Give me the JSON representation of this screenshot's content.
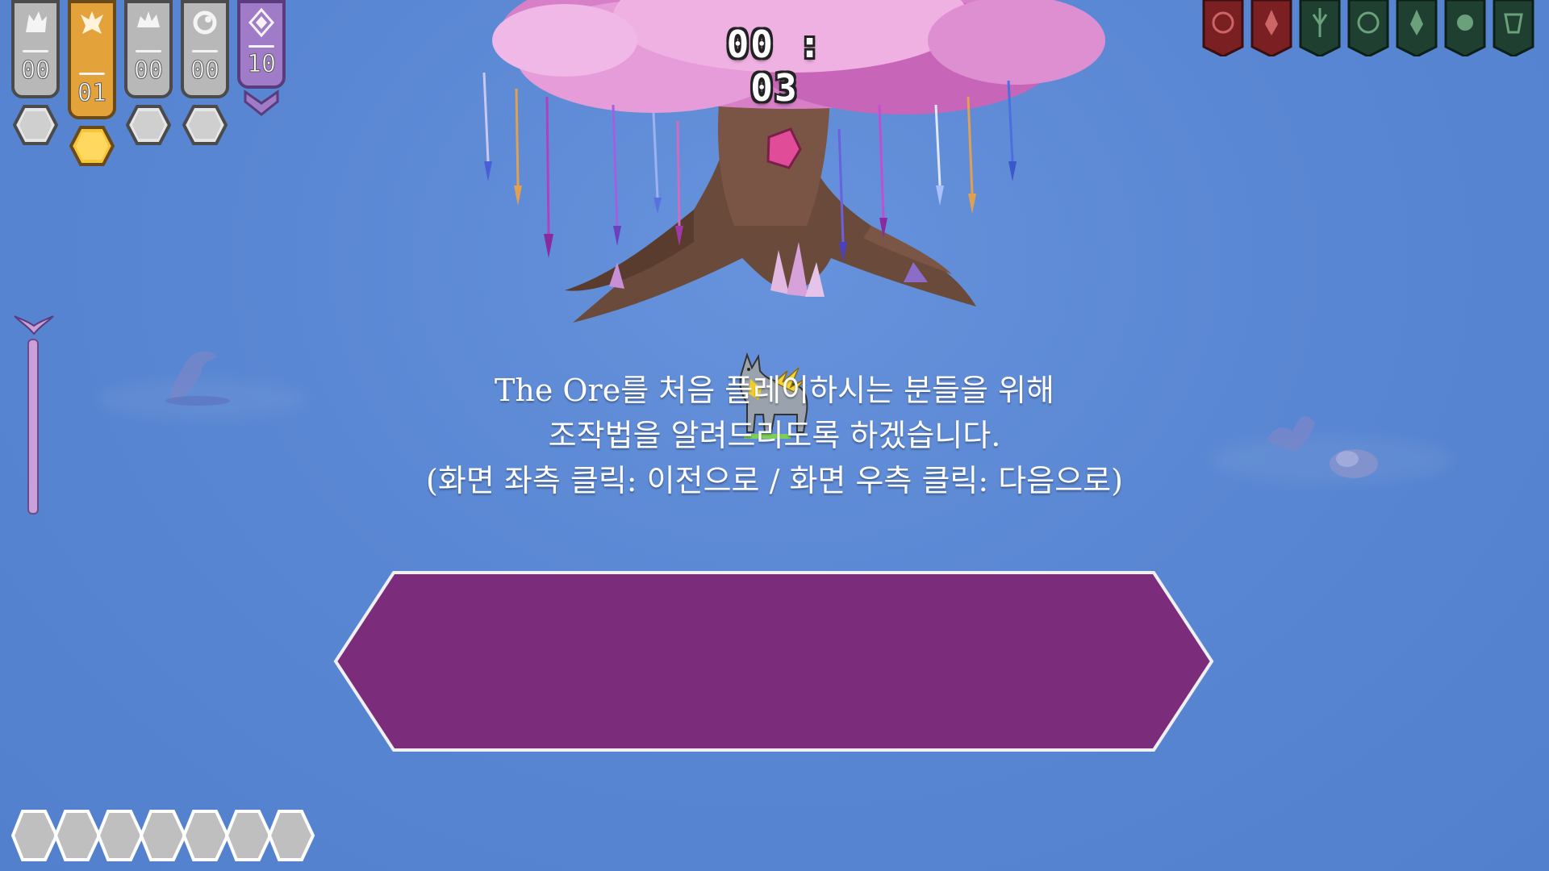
{
  "hud": {
    "timer": "00 : 03",
    "counters": [
      {
        "name": "gray-1",
        "value": "00",
        "color": "#b8b8b8",
        "gem": "gray"
      },
      {
        "name": "gold",
        "value": "01",
        "color": "#e3a33a",
        "gem": "gold"
      },
      {
        "name": "gray-2",
        "value": "00",
        "color": "#b8b8b8",
        "gem": "gray"
      },
      {
        "name": "gray-3",
        "value": "00",
        "color": "#b8b8b8",
        "gem": "gray"
      },
      {
        "name": "purple",
        "value": "10",
        "color": "#a07cc8",
        "gem": "none"
      }
    ],
    "right_banner_colors": [
      "#7a1f22",
      "#7a1f22",
      "#1f4030",
      "#1f4030",
      "#1f4030",
      "#1f4030",
      "#1f4030"
    ]
  },
  "dialog": {
    "line1": "The Ore를 처음 플레이하시는 분들을 위해",
    "line2": "조작법을 알려드리도록 하겠습니다.",
    "line3": "(화면 좌측 클릭: 이전으로 / 화면 우측 클릭: 다음으로)",
    "bg_color": "#7b2d7b"
  },
  "colors": {
    "sky": "#5b88d4",
    "canopy": "#d77fc7",
    "trunk": "#6a4a3a"
  },
  "inventory": {
    "slot_count": 7
  }
}
